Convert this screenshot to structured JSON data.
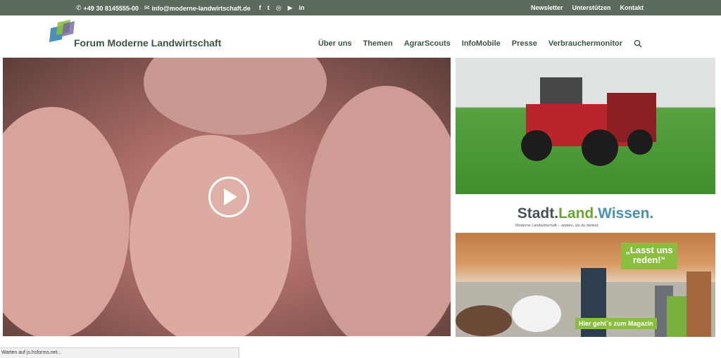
{
  "topbar": {
    "phone": "+49 30 8145555-00",
    "email": "info@moderne-landwirtschaft.de",
    "social_icons": [
      "facebook-icon",
      "twitter-icon",
      "instagram-icon",
      "youtube-icon",
      "linkedin-icon"
    ],
    "links": [
      "Newsletter",
      "Unterstützen",
      "Kontakt"
    ]
  },
  "header": {
    "brand": "Forum Moderne Landwirtschaft",
    "nav": [
      "Über uns",
      "Themen",
      "AgrarScouts",
      "InfoMobile",
      "Presse",
      "Verbrauchermonitor"
    ]
  },
  "right": {
    "slw_stadt": "Stadt.",
    "slw_land": "Land.",
    "slw_wissen": "Wissen.",
    "slw_tagline": "Moderne Landwirtschaft – anders, als du denkst.",
    "bubble_text": "„Lasst uns reden!“",
    "cta_text": "Hier geht´s zum Magazin"
  },
  "status": "Warten auf js.hsforms.net...",
  "colors": {
    "topbar": "#5d6b5c",
    "brand_text": "#3b5543",
    "accent_green": "#8bbd3f",
    "land_green": "#6aa531",
    "wissen_blue": "#4b8fb7"
  }
}
